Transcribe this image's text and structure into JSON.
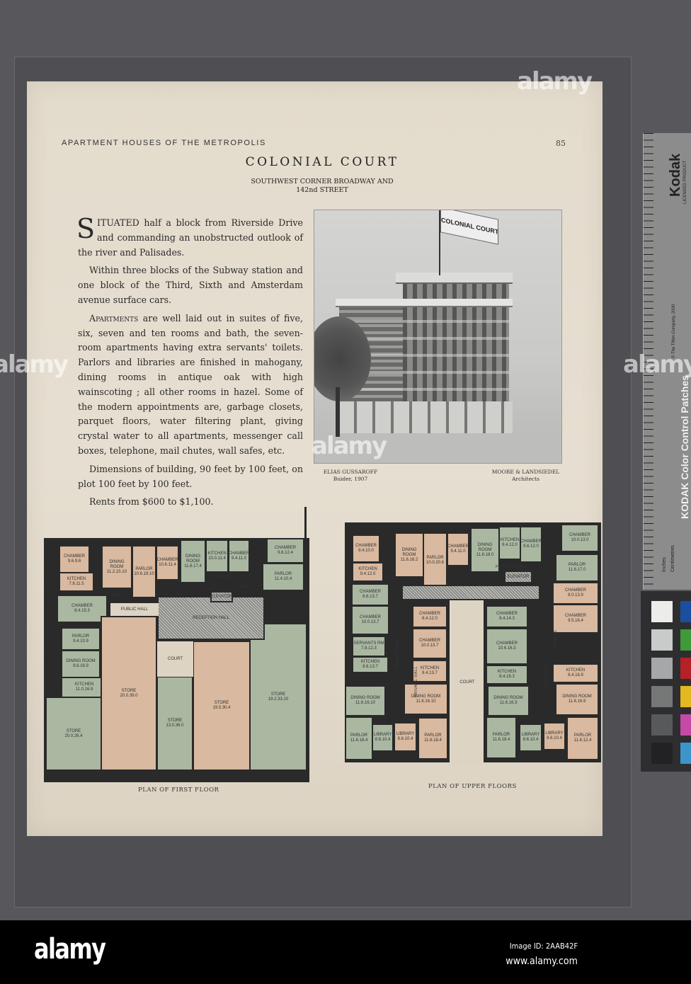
{
  "page": {
    "running_head": "APARTMENT HOUSES OF THE METROPOLIS",
    "page_number": "85",
    "title": "COLONIAL COURT",
    "subtitle_line1": "SOUTHWEST CORNER BROADWAY AND",
    "subtitle_line2": "142nd STREET"
  },
  "body": {
    "p1_dropcap": "S",
    "p1_rest": "ITUATED half a block from Riverside Drive and commanding an unobstructed outlook of the river and Palisades.",
    "p2": "Within three blocks of the Subway station and one block of the Third, Sixth and Amsterdam avenue surface cars.",
    "p3_lead": "Apartments",
    "p3_rest": " are well laid out in suites of five, six, seven and ten rooms and bath, the seven-room apartments having extra servants' toilets. Parlors and libraries are finished in mahogany, dining rooms in antique oak with high wainscoting ; all other rooms in hazel. Some of the modern appointments are, garbage closets, parquet floors, water filtering plant, giving crystal water to all apartments, messenger call boxes, telephone, mail chutes, wall safes, etc.",
    "p4": "Dimensions of building, 90 feet by 100 feet, on plot 100 feet by 100 feet.",
    "p5": "Rents from $600 to $1,100."
  },
  "photo": {
    "flag_text": "COLONIAL COURT",
    "builder_name": "ELIAS GUSSAROFF",
    "builder_role": "Buider, 1907",
    "architect_name": "MOORE & LANDSIEDEL",
    "architect_role": "Architects"
  },
  "plans": {
    "first_floor": {
      "caption": "PLAN OF FIRST FLOOR",
      "rooms": [
        {
          "name": "CHAMBER",
          "size": "9.6.9.6",
          "tint": "peach"
        },
        {
          "name": "KITCHEN",
          "size": "7.8.11.5",
          "tint": "peach"
        },
        {
          "name": "DINING ROOM",
          "size": "11.2.15.10",
          "tint": "peach"
        },
        {
          "name": "PARLOR",
          "size": "10.6.19.10",
          "tint": "peach"
        },
        {
          "name": "CHAMBER",
          "size": "10.6.11.4",
          "tint": "peach"
        },
        {
          "name": "DINING ROOM",
          "size": "11.6.17.4",
          "tint": "green"
        },
        {
          "name": "KITCHEN",
          "size": "10.0.11.4",
          "tint": "green"
        },
        {
          "name": "CHAMBER",
          "size": "9.4.11.0",
          "tint": "green"
        },
        {
          "name": "CHAMBER",
          "size": "9.8.12.4",
          "tint": "green"
        },
        {
          "name": "PARLOR",
          "size": "11.4.10.4",
          "tint": "green"
        },
        {
          "name": "CHAMBER",
          "size": "8.4.15.3",
          "tint": "green"
        },
        {
          "name": "PARLOR",
          "size": "9.4.10.9",
          "tint": "green"
        },
        {
          "name": "DINING ROOM",
          "size": "9.6.16.9",
          "tint": "green"
        },
        {
          "name": "KITCHEN",
          "size": "11.0.16.9",
          "tint": "green"
        },
        {
          "name": "STORE",
          "size": "20.0.26.4",
          "tint": "green"
        },
        {
          "name": "STORE",
          "size": "20.0.39.0",
          "tint": "peach"
        },
        {
          "name": "STORE",
          "size": "13.0.36.0",
          "tint": "green"
        },
        {
          "name": "STORE",
          "size": "19.5.30.4",
          "tint": "peach"
        },
        {
          "name": "STORE",
          "size": "19.2.33.10",
          "tint": "green"
        },
        {
          "name": "RECEPTION HALL",
          "size": "",
          "tint": "hatch"
        },
        {
          "name": "COURT",
          "size": "",
          "tint": "light"
        },
        {
          "name": "PUBLIC HALL",
          "size": "",
          "tint": "light"
        },
        {
          "name": "ELEVATOR",
          "size": "",
          "tint": "hatch"
        }
      ],
      "labels": [
        "PRIVATE",
        "HALL",
        "HALL"
      ]
    },
    "upper_floors": {
      "caption": "PLAN OF UPPER FLOORS",
      "rooms": [
        {
          "name": "CHAMBER",
          "size": "9.4.10.0",
          "tint": "peach"
        },
        {
          "name": "KITCHEN",
          "size": "9.4.12.0",
          "tint": "peach"
        },
        {
          "name": "DINING ROOM",
          "size": "11.6.16.2",
          "tint": "peach"
        },
        {
          "name": "PARLOR",
          "size": "10.0.20.6",
          "tint": "peach"
        },
        {
          "name": "CHAMBER",
          "size": "9.4.11.0",
          "tint": "peach"
        },
        {
          "name": "DINING ROOM",
          "size": "11.8.18.0",
          "tint": "green"
        },
        {
          "name": "KITCHEN",
          "size": "8.4.12.0",
          "tint": "green"
        },
        {
          "name": "CHAMBER",
          "size": "9.6.12.0",
          "tint": "green"
        },
        {
          "name": "CHAMBER",
          "size": "10.0.13.0",
          "tint": "green"
        },
        {
          "name": "PARLOR",
          "size": "11.6.17.0",
          "tint": "green"
        },
        {
          "name": "CHAMBER",
          "size": "8.6.13.7",
          "tint": "green"
        },
        {
          "name": "CHAMBER",
          "size": "10.0.13.7",
          "tint": "green"
        },
        {
          "name": "SERVANTS RM",
          "size": "7.8.12.3",
          "tint": "green"
        },
        {
          "name": "KITCHEN",
          "size": "8.6.13.7",
          "tint": "green"
        },
        {
          "name": "DINING ROOM",
          "size": "11.6.16.10",
          "tint": "green"
        },
        {
          "name": "PARLOR",
          "size": "11.6.18.4",
          "tint": "green"
        },
        {
          "name": "LIBRARY",
          "size": "8.6.10.4",
          "tint": "green"
        },
        {
          "name": "CHAMBER",
          "size": "8.4.12.0",
          "tint": "peach"
        },
        {
          "name": "CHAMBER",
          "size": "10.0.13.7",
          "tint": "peach"
        },
        {
          "name": "KITCHEN",
          "size": "8.4.13.7",
          "tint": "peach"
        },
        {
          "name": "DINING ROOM",
          "size": "11.6.16.10",
          "tint": "peach"
        },
        {
          "name": "LIBRARY",
          "size": "8.6.10.4",
          "tint": "peach"
        },
        {
          "name": "PARLOR",
          "size": "11.6.18.4",
          "tint": "peach"
        },
        {
          "name": "CHAMBER",
          "size": "8.4.14.3",
          "tint": "green"
        },
        {
          "name": "CHAMBER",
          "size": "10.6.16.3",
          "tint": "green"
        },
        {
          "name": "KITCHEN",
          "size": "8.4.16.3",
          "tint": "green"
        },
        {
          "name": "DINING ROOM",
          "size": "11.6.16.3",
          "tint": "green"
        },
        {
          "name": "PARLOR",
          "size": "11.6.18.4",
          "tint": "green"
        },
        {
          "name": "LIBRARY",
          "size": "8.6.10.4",
          "tint": "green"
        },
        {
          "name": "CHAMBER",
          "size": "8.0.13.9",
          "tint": "peach"
        },
        {
          "name": "CHAMBER",
          "size": "9.5.16.4",
          "tint": "peach"
        },
        {
          "name": "KITCHEN",
          "size": "8.4.16.9",
          "tint": "peach"
        },
        {
          "name": "DINING ROOM",
          "size": "11.6.16.9",
          "tint": "peach"
        },
        {
          "name": "LIBRARY",
          "size": "8.6.10.4",
          "tint": "peach"
        },
        {
          "name": "PARLOR",
          "size": "11.6.12.4",
          "tint": "peach"
        },
        {
          "name": "COURT",
          "size": "",
          "tint": "light"
        },
        {
          "name": "",
          "size": "",
          "tint": "hatch"
        },
        {
          "name": "ELEVATOR",
          "size": "",
          "tint": "hatch"
        }
      ],
      "labels": [
        "PRIVATE HALL",
        "PRIVATE HALL",
        "PRIVATE HALL",
        "PRIVATE HALL",
        "PRIVATE"
      ]
    }
  },
  "target": {
    "brand": "Kodak",
    "brand_sub": "LICENSED PRODUCT",
    "copyright": "© The Tiffen Company, 2000",
    "product": "KODAK Color Control Patches",
    "inches_label": "Inches",
    "cm_label": "Centimetres",
    "gray_patches": [
      "#ececea",
      "#c9cbcb",
      "#a5a7a8",
      "#767878",
      "#58595b",
      "#222224"
    ],
    "color_patches": [
      "#1a4fa0",
      "#3f9a3a",
      "#b52126",
      "#e3b820",
      "#c44aa5",
      "#3b95c8"
    ]
  },
  "colors": {
    "peach": "#d9b99f",
    "green": "#aab8a2",
    "paper": "#e3dbcc",
    "background": "#58585c"
  },
  "footer": {
    "logo": "alamy",
    "image_id": "Image ID: 2AAB42F",
    "url": "www.alamy.com"
  }
}
